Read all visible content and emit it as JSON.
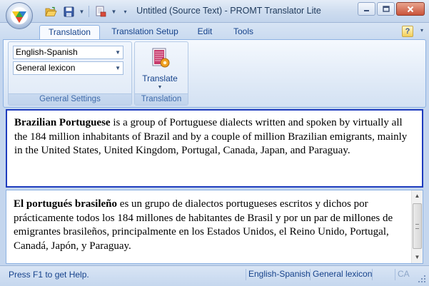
{
  "window": {
    "title": "Untitled (Source Text) - PROMT Translator Lite"
  },
  "quick_access": {
    "icons": [
      "open-folder-icon",
      "save-icon",
      "print-setup-icon"
    ]
  },
  "tabs": [
    {
      "label": "Translation",
      "active": true
    },
    {
      "label": "Translation Setup",
      "active": false
    },
    {
      "label": "Edit",
      "active": false
    },
    {
      "label": "Tools",
      "active": false
    }
  ],
  "help": {
    "label": "?"
  },
  "ribbon": {
    "general_settings": {
      "direction_value": "English-Spanish",
      "lexicon_value": "General lexicon",
      "label": "General Settings"
    },
    "translation": {
      "translate_label": "Translate",
      "label": "Translation"
    }
  },
  "source": {
    "bold": "Brazilian Portuguese",
    "rest": " is a group of Portuguese dialects written and spoken by virtually all the 184 million inhabitants of Brazil and by a couple of million Brazilian emigrants, mainly in the United States, United Kingdom, Portugal, Canada, Japan, and Paraguay."
  },
  "target": {
    "bold": "El portugués brasileño",
    "rest": " es un grupo de dialectos portugueses escritos y dichos por prácticamente todos los 184 millones de habitantes de Brasil y por un par de millones de emigrantes brasileños, principalmente en los Estados Unidos, el Reino Unido, Portugal, Canadá, Japón, y Paraguay."
  },
  "status": {
    "help_text": "Press F1 to get Help.",
    "direction": "English-Spanish",
    "lexicon": "General lexicon",
    "caps": "CA"
  },
  "colors": {
    "accent": "#15428b",
    "active_pane_border": "#1e3cbe"
  }
}
